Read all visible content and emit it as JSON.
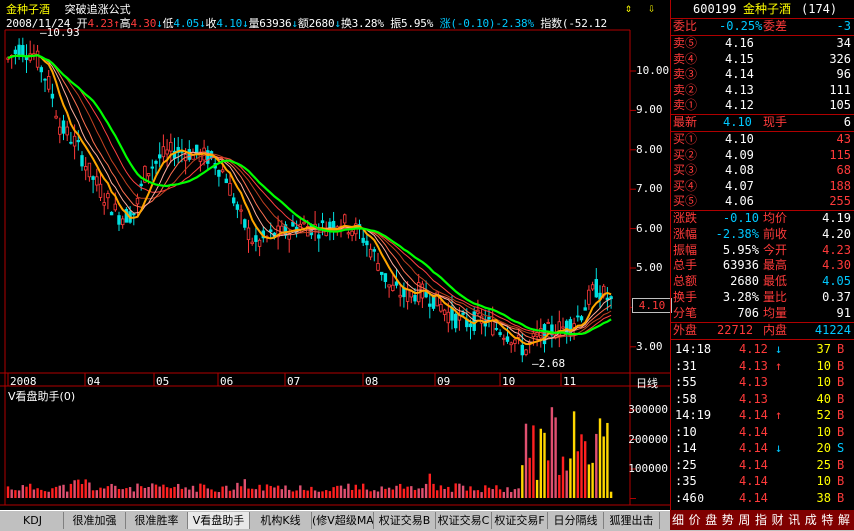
{
  "header": {
    "stock_name": "金种子酒",
    "indicator": "突破追涨公式",
    "date": "2008/11/24",
    "open_label": "开",
    "open": "4.23",
    "high_label": "高",
    "high": "4.30",
    "low_label": "低",
    "low": "4.05",
    "close_label": "收",
    "close": "4.10",
    "volume_label": "量",
    "volume": "63936",
    "amount_label": "额",
    "amount": "2680",
    "turnover_label": "换",
    "turnover": "3.28%",
    "amplitude_label": "振",
    "amplitude": "5.95%",
    "change_label": "涨",
    "change": "(-0.10)-2.38%",
    "index_label": "指数",
    "index": "(-52.12"
  },
  "price_axis": [
    "10.00",
    "9.00",
    "8.00",
    "7.00",
    "6.00",
    "5.00",
    "4.00",
    "3.00"
  ],
  "price_tag": "4.10",
  "annot_high": "10.93",
  "annot_low": "2.68",
  "date_axis": [
    "2008",
    "04",
    "05",
    "06",
    "07",
    "08",
    "09",
    "10",
    "11"
  ],
  "period_label": "日线",
  "subchart_title": "V看盘助手(0)",
  "volume_axis": [
    "300000",
    "200000",
    "100000",
    "0"
  ],
  "panel": {
    "code": "600199",
    "name": "金种子酒",
    "rank": "(174)",
    "weibi_label": "委比",
    "weibi": "-0.25%",
    "weicha_label": "委差",
    "weicha": "-3",
    "sells": [
      {
        "label": "卖⑤",
        "price": "4.16",
        "vol": "34"
      },
      {
        "label": "卖④",
        "price": "4.15",
        "vol": "326"
      },
      {
        "label": "卖③",
        "price": "4.14",
        "vol": "96"
      },
      {
        "label": "卖②",
        "price": "4.13",
        "vol": "111"
      },
      {
        "label": "卖①",
        "price": "4.12",
        "vol": "105"
      }
    ],
    "latest_label": "最新",
    "latest": "4.10",
    "xianshou_label": "现手",
    "xianshou": "6",
    "buys": [
      {
        "label": "买①",
        "price": "4.10",
        "vol": "43"
      },
      {
        "label": "买②",
        "price": "4.09",
        "vol": "115"
      },
      {
        "label": "买③",
        "price": "4.08",
        "vol": "68"
      },
      {
        "label": "买④",
        "price": "4.07",
        "vol": "188"
      },
      {
        "label": "买⑤",
        "price": "4.06",
        "vol": "255"
      }
    ],
    "stats": [
      {
        "l1": "涨跌",
        "v1": "-0.10",
        "l2": "均价",
        "v2": "4.19"
      },
      {
        "l1": "涨幅",
        "v1": "-2.38%",
        "l2": "前收",
        "v2": "4.20"
      },
      {
        "l1": "振幅",
        "v1": "5.95%",
        "l2": "今开",
        "v2": "4.23"
      },
      {
        "l1": "总手",
        "v1": "63936",
        "l2": "最高",
        "v2": "4.30"
      },
      {
        "l1": "总额",
        "v1": "2680",
        "l2": "最低",
        "v2": "4.05"
      },
      {
        "l1": "换手",
        "v1": "3.28%",
        "l2": "量比",
        "v2": "0.37"
      },
      {
        "l1": "分笔",
        "v1": "706",
        "l2": "均量",
        "v2": "91"
      }
    ],
    "waipan_label": "外盘",
    "waipan": "22712",
    "neipan_label": "内盘",
    "neipan": "41224",
    "ticks": [
      {
        "time": "14:18",
        "price": "4.12",
        "arrow": "↓",
        "vol": "37",
        "side": "B"
      },
      {
        "time": ":31",
        "price": "4.13",
        "arrow": "↑",
        "vol": "10",
        "side": "B"
      },
      {
        "time": ":55",
        "price": "4.13",
        "arrow": "",
        "vol": "10",
        "side": "B"
      },
      {
        "time": ":58",
        "price": "4.13",
        "arrow": "",
        "vol": "40",
        "side": "B"
      },
      {
        "time": "14:19",
        "price": "4.14",
        "arrow": "↑",
        "vol": "52",
        "side": "B"
      },
      {
        "time": ":10",
        "price": "4.14",
        "arrow": "",
        "vol": "10",
        "side": "B"
      },
      {
        "time": ":14",
        "price": "4.14",
        "arrow": "↓",
        "vol": "20",
        "side": "S"
      },
      {
        "time": ":25",
        "price": "4.14",
        "arrow": "",
        "vol": "25",
        "side": "B"
      },
      {
        "time": ":35",
        "price": "4.14",
        "arrow": "",
        "vol": "10",
        "side": "B"
      },
      {
        "time": ":46",
        "price": "4.14",
        "arrow": "",
        "vol": "38",
        "side": "B"
      }
    ]
  },
  "tabs": [
    "KDJ",
    "很准加强",
    "很准胜率",
    "V看盘助手",
    "机构K线",
    "(修V超级MACD",
    "权证交易B",
    "权证交易C",
    "权证交易F",
    "日分隔线",
    "狐狸出击"
  ],
  "right_tabs": [
    "细",
    "价",
    "盘",
    "势",
    "周",
    "指",
    "财",
    "讯",
    "成",
    "特",
    "解"
  ],
  "colors": {
    "up": "#ff3a3a",
    "down": "#00e0e0",
    "ma_green": "#00ff00",
    "ma_orange": "#ff8c00",
    "border": "#b00000"
  }
}
